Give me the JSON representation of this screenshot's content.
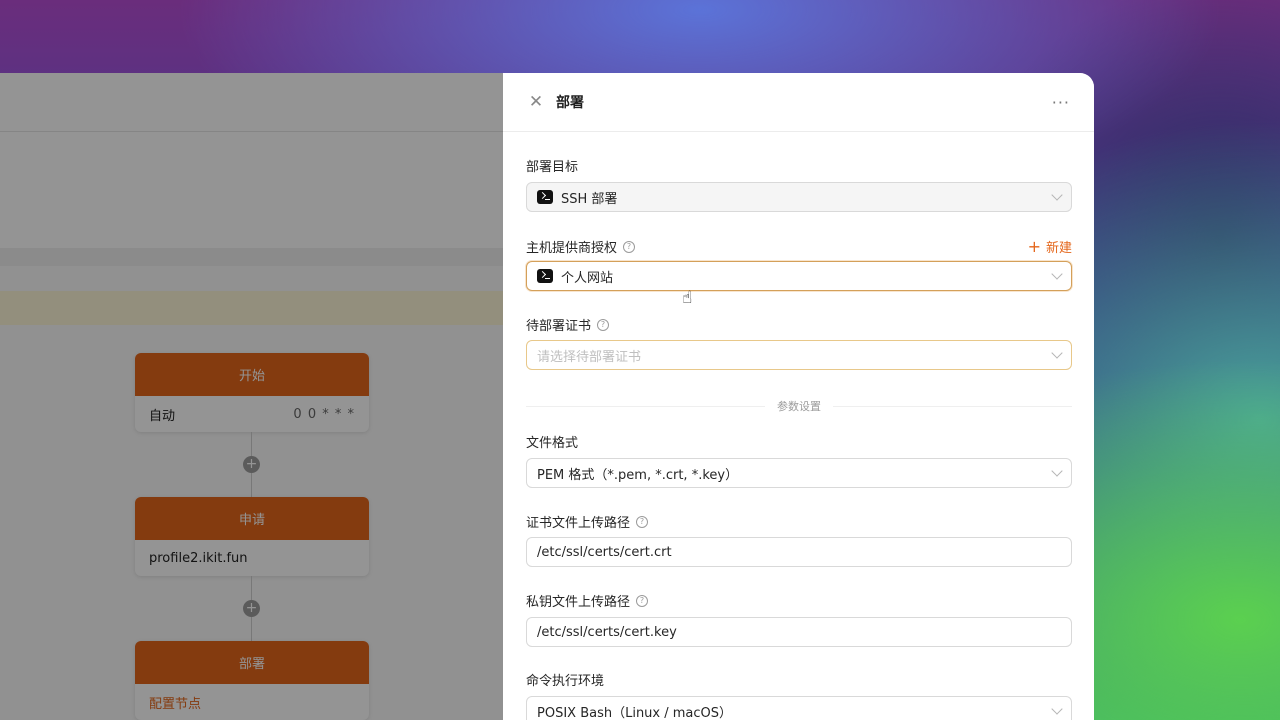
{
  "canvas": {
    "nodes": [
      {
        "title": "开始",
        "body_left": "自动",
        "body_right": "0 0 * * *"
      },
      {
        "title": "申请",
        "body_left": "profile2.ikit.fun",
        "body_right": ""
      },
      {
        "title": "部署",
        "body_left": "配置节点",
        "body_right": ""
      }
    ],
    "add_symbol": "+"
  },
  "drawer": {
    "title": "部署",
    "close_symbol": "✕",
    "more_symbol": "···",
    "fields": {
      "target": {
        "label": "部署目标",
        "value": "SSH 部署"
      },
      "access": {
        "label": "主机提供商授权",
        "value": "个人网站",
        "new_label": "新建"
      },
      "certificate": {
        "label": "待部署证书",
        "placeholder": "请选择待部署证书"
      },
      "divider": "参数设置",
      "format": {
        "label": "文件格式",
        "value": "PEM 格式（*.pem, *.crt, *.key）"
      },
      "cert_path": {
        "label": "证书文件上传路径",
        "value": "/etc/ssl/certs/cert.crt"
      },
      "key_path": {
        "label": "私钥文件上传路径",
        "value": "/etc/ssl/certs/cert.key"
      },
      "shell": {
        "label": "命令执行环境",
        "value": "POSIX Bash（Linux / macOS）"
      }
    }
  },
  "colors": {
    "accent": "#e4661b",
    "node_header": "#e4661b"
  }
}
